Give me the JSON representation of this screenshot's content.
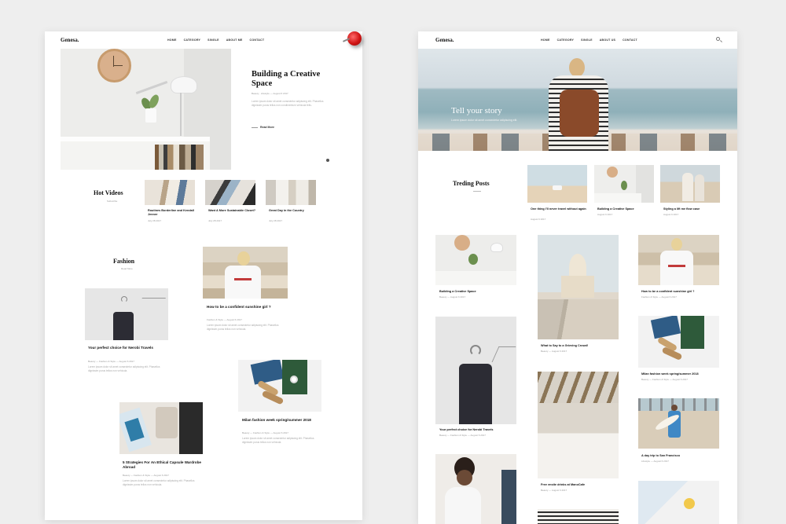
{
  "pageA": {
    "logo": "Genesa.",
    "nav": [
      "HOME",
      "CATEGORY",
      "SINGLE",
      "ABOUT ME",
      "CONTACT"
    ],
    "hero": {
      "title": "Building a Creative Space",
      "meta": "Beauty , Lifestyle — August 6 2017",
      "excerpt": "Lorem ipsum dolor sit amet consectetur adipiscing elit. Phasellus dignissim purus tellus non condimentum vehicula felis.",
      "read_more": "Read More"
    },
    "hot_videos": {
      "title": "Hot Videos",
      "sub": "Subscribe",
      "items": [
        {
          "title": "Routines Borderline and Kendall Jenner",
          "date": "July 28 2017"
        },
        {
          "title": "Want A More Sustainable Closet?",
          "date": "July 28 2017"
        },
        {
          "title": "Great Day in the Country",
          "date": "July 28 2017"
        }
      ]
    },
    "fashion": {
      "title": "Fashion",
      "sub": "Read More",
      "posts": [
        {
          "title": "How to be a confident sunshine girl ?",
          "meta": "Fashion & Style — August 6 2017",
          "excerpt": "Lorem ipsum dolor sit amet consectetur adipiscing elit. Phasellus dignissim purus tellus non vehicula."
        },
        {
          "title": "Your perfect choice for Nerobi Travels",
          "meta": "Beauty — Fashion & Style — August 6 2017",
          "excerpt": "Lorem ipsum dolor sit amet consectetur adipiscing elit. Phasellus dignissim purus tellus non vehicula."
        },
        {
          "title": "Milan fashion week spring/summer 2018",
          "meta": "Beauty — Fashion & Style — August 6 2017",
          "excerpt": "Lorem ipsum dolor sit amet consectetur adipiscing elit. Phasellus dignissim purus tellus non vehicula."
        },
        {
          "title": "5 Strategies For An Ethical Capsule Wardrobe Abroad",
          "meta": "Beauty — Fashion & Style — August 6 2017",
          "excerpt": "Lorem ipsum dolor sit amet consectetur adipiscing elit. Phasellus dignissim purus tellus non vehicula."
        }
      ]
    }
  },
  "pageB": {
    "logo": "Genesa.",
    "nav": [
      "HOME",
      "CATEGORY",
      "SINGLE",
      "ABOUT US",
      "CONTACT"
    ],
    "hero": {
      "title": "Tell your story",
      "sub": "Lorem ipsum dolor sit amet consectetur adipiscing elit."
    },
    "trending": {
      "title": "Treding Posts",
      "items": [
        {
          "title": "One thing I'll never travel without again",
          "date": "August 6 2017"
        },
        {
          "title": "Building a Creative Space",
          "date": "August 6 2017"
        },
        {
          "title": "Styling a lift me flow case",
          "date": "August 6 2017"
        }
      ]
    },
    "grid": [
      {
        "title": "Building a Creative Space",
        "meta": "Beauty — August 6 2017"
      },
      {
        "title": "What to Say to a Grieving Crowd!",
        "meta": "Beauty — August 6 2017"
      },
      {
        "title": "How to be a confident sunshine girl ?",
        "meta": "Fashion & Style — August 6 2017"
      },
      {
        "title": "Your perfect choice for Nerobi Travels",
        "meta": "Beauty — Fashion & Style — August 6 2017"
      },
      {
        "title": "Milan fashion week spring/summer 2018",
        "meta": "Beauty — Fashion & Style — August 6 2017"
      },
      {
        "title": "Free ensite drinks at ManoCafe",
        "meta": "Beauty — August 6 2017"
      },
      {
        "title": "A day trip to San Francisco",
        "meta": "Lifestyle — August 6 2017"
      }
    ]
  }
}
